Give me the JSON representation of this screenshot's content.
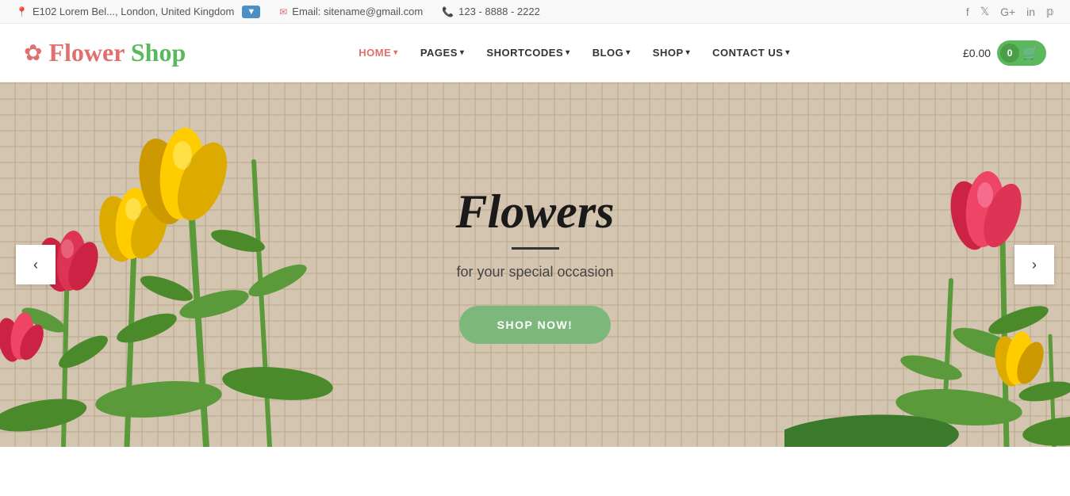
{
  "topbar": {
    "address": "E102 Lorem Bel..., London, United Kingdom",
    "email": "Email: sitename@gmail.com",
    "phone": "123 - 8888 - 2222",
    "social": [
      "f",
      "t",
      "g+",
      "in",
      "p"
    ]
  },
  "header": {
    "logo": {
      "flower_text": "Flower ",
      "shop_text": "Shop"
    },
    "nav": [
      {
        "label": "HOME",
        "has_dropdown": true,
        "active": true
      },
      {
        "label": "PAGES",
        "has_dropdown": true,
        "active": false
      },
      {
        "label": "SHORTCODES",
        "has_dropdown": true,
        "active": false
      },
      {
        "label": "BLOG",
        "has_dropdown": true,
        "active": false
      },
      {
        "label": "SHOP",
        "has_dropdown": true,
        "active": false
      },
      {
        "label": "CONTACT US",
        "has_dropdown": true,
        "active": false
      }
    ],
    "cart": {
      "price": "£0.00",
      "count": "0"
    }
  },
  "hero": {
    "title": "Flowers",
    "subtitle": "for your special occasion",
    "button_label": "SHOP NOW!",
    "prev_arrow": "‹",
    "next_arrow": "›"
  }
}
